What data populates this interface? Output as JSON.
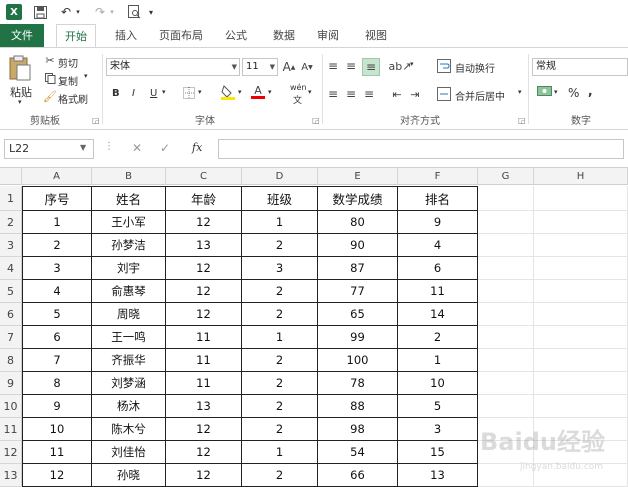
{
  "qat": {
    "excel_icon": "X",
    "save_icon": "save-icon",
    "undo_icon": "undo-icon",
    "redo_icon": "redo-icon",
    "preview_icon": "print-preview-icon"
  },
  "tabs": [
    "文件",
    "开始",
    "插入",
    "页面布局",
    "公式",
    "数据",
    "审阅",
    "视图"
  ],
  "ribbon": {
    "clipboard": {
      "paste": "粘贴",
      "cut": "剪切",
      "copy": "复制",
      "format_painter": "格式刷",
      "label": "剪贴板"
    },
    "font": {
      "font_name": "宋体",
      "font_size": "11",
      "bold": "B",
      "italic": "I",
      "underline": "U",
      "wen": "wén",
      "wen_sub": "文",
      "label": "字体"
    },
    "alignment": {
      "wrap_text": "自动换行",
      "merge_center": "合并后居中",
      "label": "对齐方式"
    },
    "number": {
      "format": "常规",
      "percent": "%",
      "label": "数字"
    }
  },
  "formula_bar": {
    "name_box": "L22",
    "fx": "fx",
    "cancel": "✕",
    "enter": "✓"
  },
  "sheet": {
    "columns": [
      "A",
      "B",
      "C",
      "D",
      "E",
      "F",
      "G",
      "H"
    ],
    "rows": [
      "1",
      "2",
      "3",
      "4",
      "5",
      "6",
      "7",
      "8",
      "9",
      "10",
      "11",
      "12",
      "13"
    ],
    "header": [
      "序号",
      "姓名",
      "年龄",
      "班级",
      "数学成绩",
      "排名"
    ],
    "data": [
      [
        "1",
        "王小军",
        "12",
        "1",
        "80",
        "9"
      ],
      [
        "2",
        "孙梦洁",
        "13",
        "2",
        "90",
        "4"
      ],
      [
        "3",
        "刘宇",
        "12",
        "3",
        "87",
        "6"
      ],
      [
        "4",
        "俞惠琴",
        "12",
        "2",
        "77",
        "11"
      ],
      [
        "5",
        "周晓",
        "12",
        "2",
        "65",
        "14"
      ],
      [
        "6",
        "王一鸣",
        "11",
        "1",
        "99",
        "2"
      ],
      [
        "7",
        "齐振华",
        "11",
        "2",
        "100",
        "1"
      ],
      [
        "8",
        "刘梦涵",
        "11",
        "2",
        "78",
        "10"
      ],
      [
        "9",
        "杨沐",
        "13",
        "2",
        "88",
        "5"
      ],
      [
        "10",
        "陈木兮",
        "12",
        "2",
        "98",
        "3"
      ],
      [
        "11",
        "刘佳怡",
        "12",
        "1",
        "54",
        "15"
      ],
      [
        "12",
        "孙晓",
        "12",
        "2",
        "66",
        "13"
      ]
    ]
  },
  "watermark": {
    "text": "Baidu经验",
    "url": "jingyan.baidu.com"
  },
  "colors": {
    "excel_green": "#217346",
    "grid_line": "#e4e4e4",
    "table_border": "#222222"
  }
}
